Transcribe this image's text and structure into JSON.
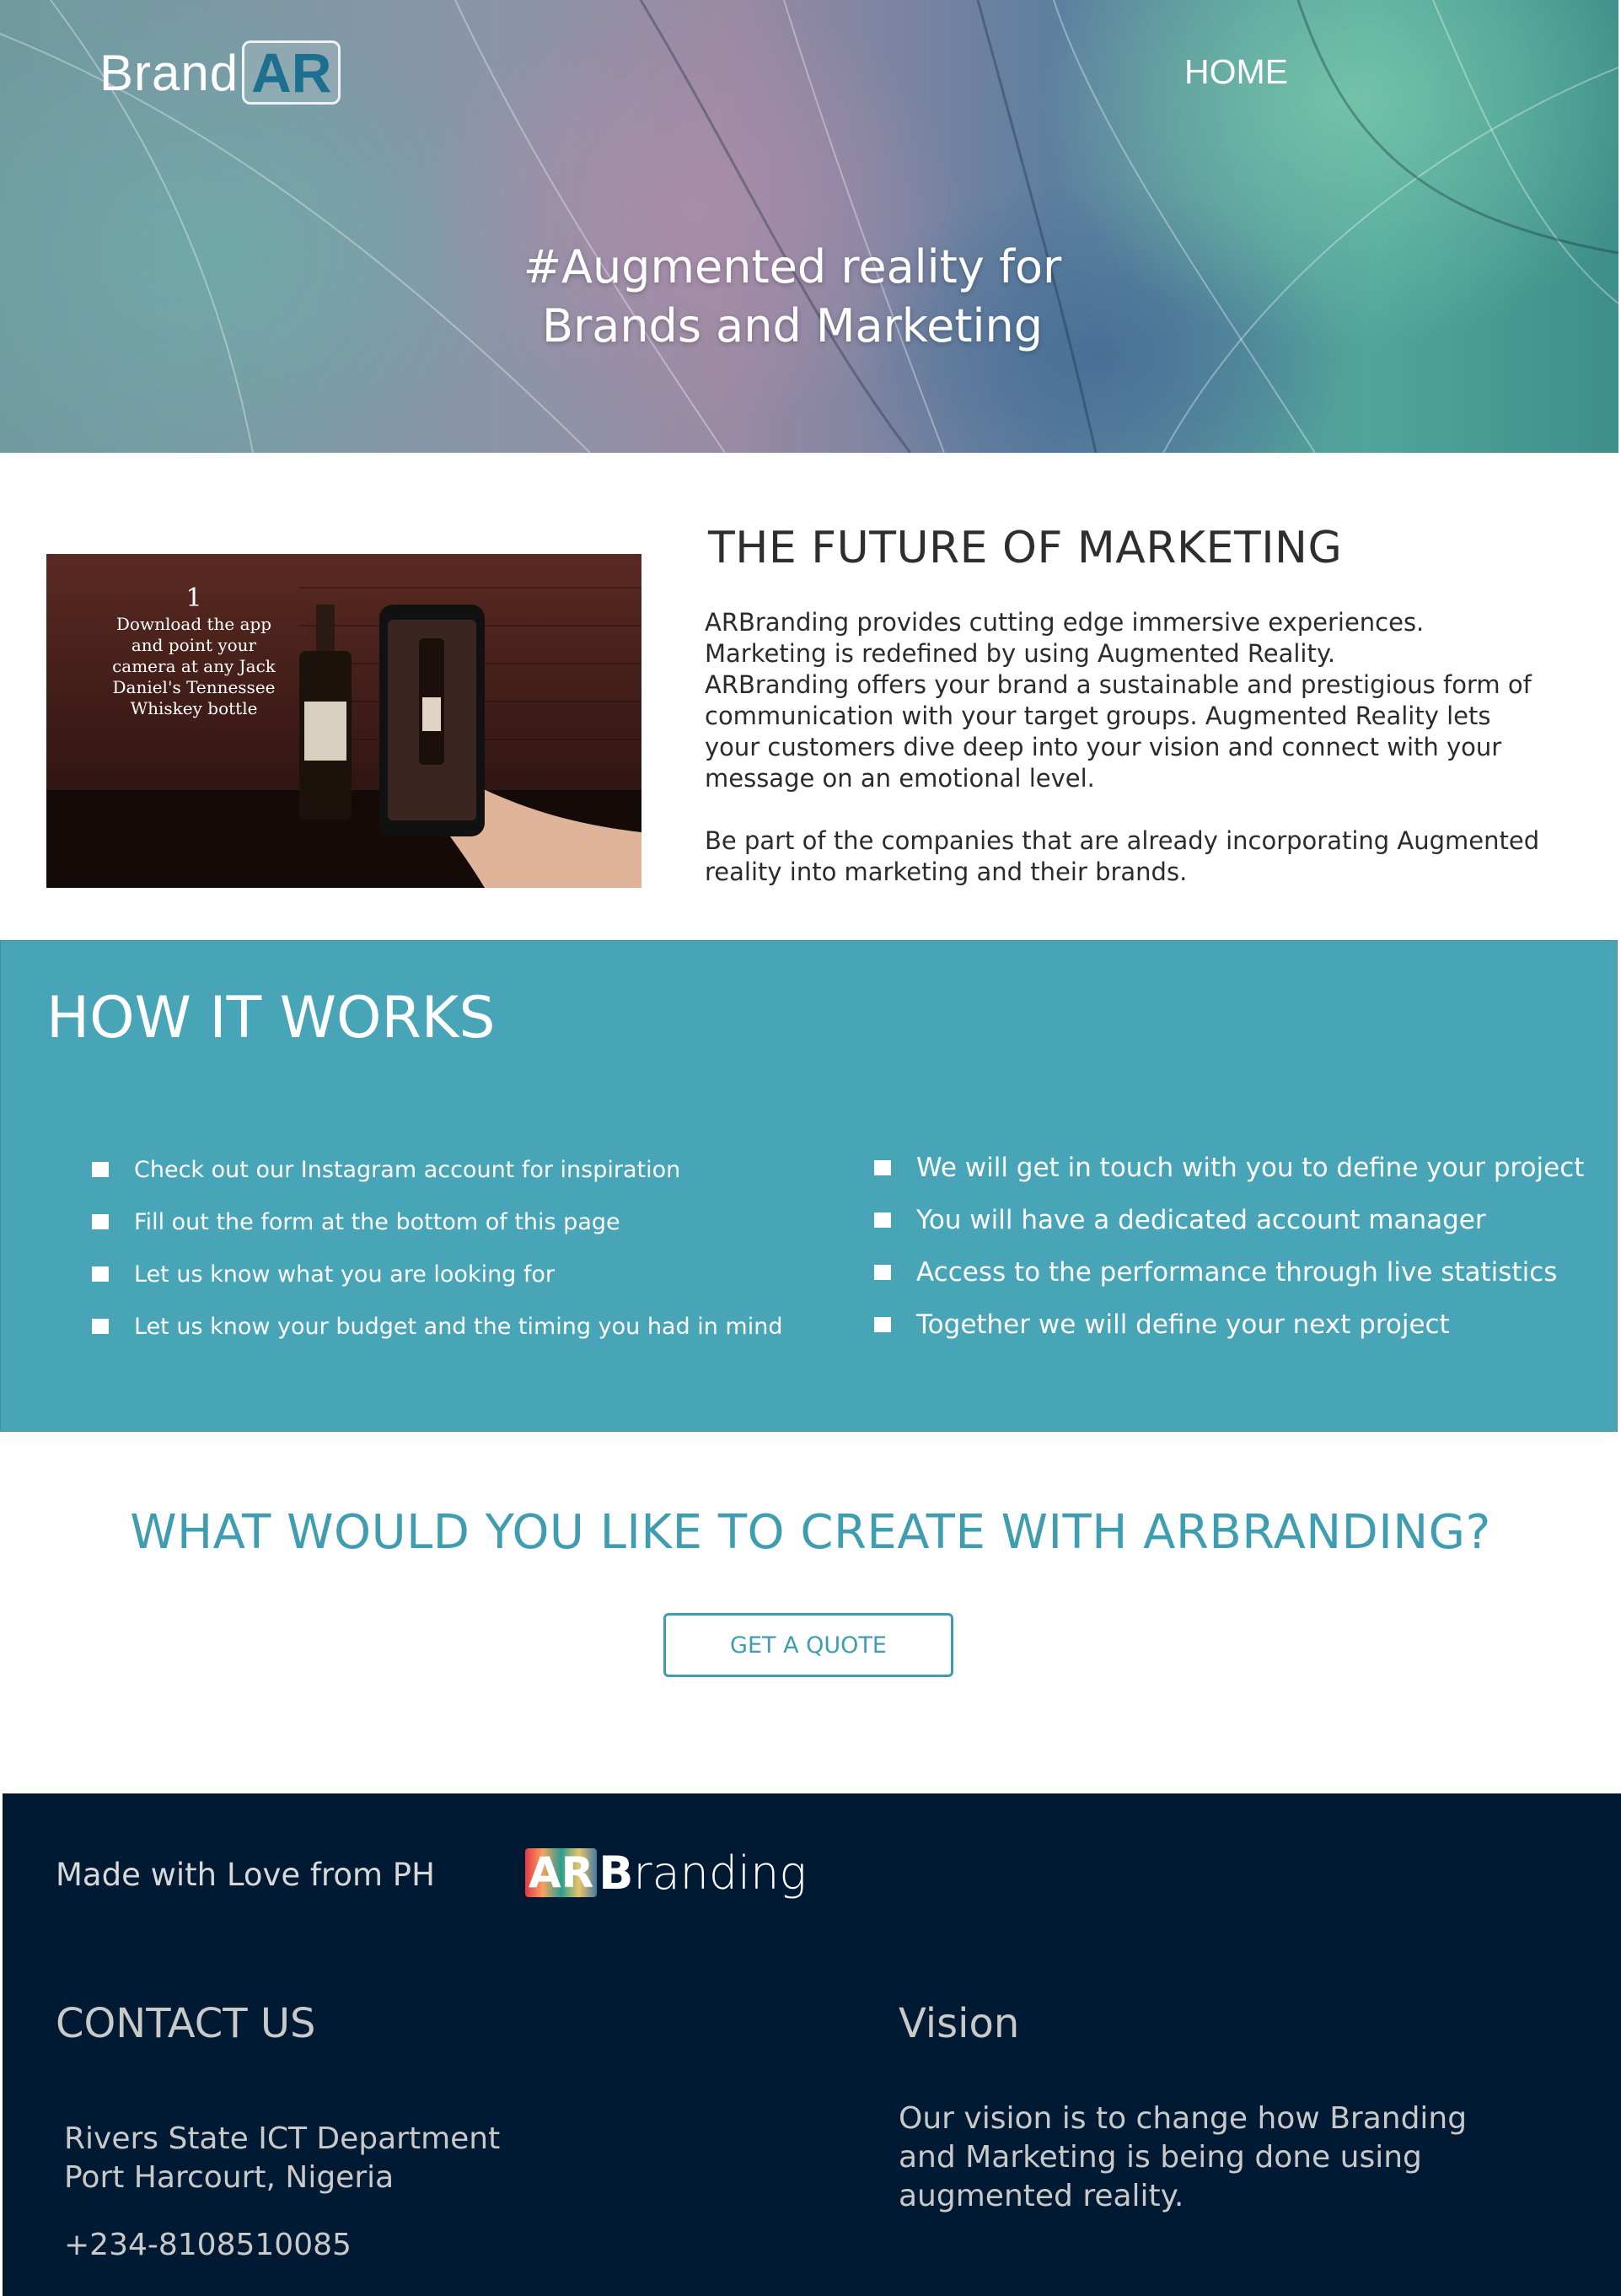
{
  "header": {
    "logo_brand": "Brand",
    "logo_ar": "AR",
    "nav_home": "HOME",
    "hero_title_line1": "#Augmented reality for",
    "hero_title_line2": "Brands and Marketing"
  },
  "future": {
    "photo_step": "1",
    "photo_caption": "Download the app and point your camera at any Jack Daniel's Tennessee Whiskey bottle",
    "title": "THE FUTURE OF MARKETING",
    "para1_line1": "ARBranding provides cutting edge immersive experiences.",
    "para1_line2": "Marketing is redefined by using Augmented Reality.",
    "para1_line3": "ARBranding offers your brand a sustainable and prestigious form of communication with your target groups. Augmented Reality lets your customers dive deep into your vision and connect with your message on an emotional level.",
    "para2": "Be part of the companies that are already incorporating Augmented reality into marketing and  their brands."
  },
  "how_it_works": {
    "title": "HOW IT WORKS",
    "left_items": [
      "Check out our Instagram account for inspiration",
      "Fill out the form at the bottom of this page",
      "Let us know what you are looking for",
      "Let us know your budget and the timing you had in mind"
    ],
    "right_items": [
      "We will get in touch with you to define your project",
      "You will have a dedicated account manager",
      "Access to the performance through live statistics",
      "Together we will define your next project"
    ]
  },
  "cta": {
    "title": "WHAT WOULD YOU LIKE TO CREATE WITH ARBRANDING?",
    "button_label": "GET A QUOTE"
  },
  "footer": {
    "made_with": "Made with Love from PH",
    "logo_ar": "AR",
    "logo_b": "B",
    "logo_rest": "randing",
    "contact_title": "CONTACT US",
    "address_line1": "Rivers State ICT Department",
    "address_line2": "Port Harcourt, Nigeria",
    "phone": "+234-8108510085",
    "vision_title": "Vision",
    "vision_text": "Our vision is to change how Branding and Marketing is being done using augmented reality."
  },
  "colors": {
    "accent_teal": "#48a5b7",
    "cta_teal": "#3f9db1",
    "footer_navy": "#001a33",
    "logo_ar_blue": "#1c6f8e"
  }
}
